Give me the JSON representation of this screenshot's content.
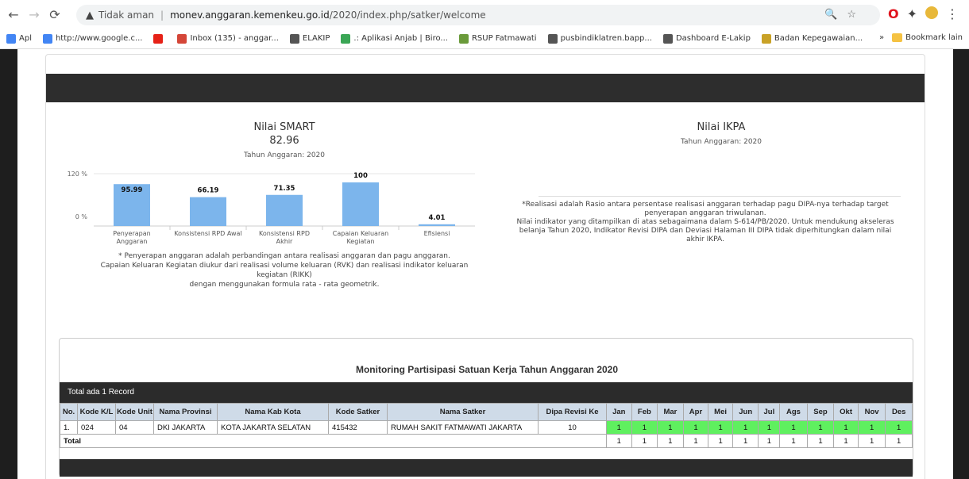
{
  "browser": {
    "security_label": "Tidak aman",
    "url_domain": "monev.anggaran.kemenkeu.go.id",
    "url_path": "/2020/index.php/satker/welcome"
  },
  "bookmarks": [
    {
      "label": "Apl",
      "icon": "apps-icon",
      "color": "#4285f4"
    },
    {
      "label": "http://www.google.c...",
      "icon": "google-icon",
      "color": "#4285f4"
    },
    {
      "label": "",
      "icon": "youtube-icon",
      "color": "#e62117"
    },
    {
      "label": "Inbox (135) - anggar...",
      "icon": "gmail-icon",
      "color": "#d44638"
    },
    {
      "label": "ELAKIP",
      "icon": "globe-icon",
      "color": "#555555"
    },
    {
      "label": ".: Aplikasi Anjab | Biro...",
      "icon": "star-icon",
      "color": "#3aa655"
    },
    {
      "label": "RSUP Fatmawati",
      "icon": "hospital-icon",
      "color": "#6a9a3a"
    },
    {
      "label": "pusbindiklatren.bapp...",
      "icon": "globe-icon",
      "color": "#555555"
    },
    {
      "label": "Dashboard E-Lakip",
      "icon": "globe-icon",
      "color": "#555555"
    },
    {
      "label": "Badan Kepegawaian...",
      "icon": "garuda-icon",
      "color": "#c9a227"
    }
  ],
  "bookmarks_more": "»",
  "bookmarks_other": "Bookmark lain",
  "smart": {
    "title": "Nilai SMART",
    "value": "82.96",
    "year": "Tahun Anggaran: 2020",
    "note_lines": [
      "* Penyerapan anggaran adalah perbandingan antara realisasi anggaran dan pagu anggaran.",
      "Capaian Keluaran Kegiatan diukur dari realisasi volume keluaran (RVK) dan realisasi indikator keluaran",
      "kegiatan (RIKK)",
      "dengan menggunakan formula rata - rata geometrik."
    ]
  },
  "ikpa": {
    "title": "Nilai IKPA",
    "year": "Tahun Anggaran: 2020",
    "note_lines": [
      "*Realisasi adalah Rasio antara persentase realisasi anggaran terhadap pagu DIPA-nya terhadap target",
      "penyerapan anggaran triwulanan.",
      "Nilai indikator yang ditampilkan di atas sebagaimana dalam S-614/PB/2020. Untuk mendukung akseleras",
      "belanja Tahun 2020, Indikator Revisi DIPA dan Deviasi Halaman III DIPA tidak diperhitungkan dalam nilai",
      "akhir IKPA."
    ]
  },
  "chart_data": {
    "type": "bar",
    "categories": [
      [
        "Penyerapan",
        "Anggaran"
      ],
      [
        "Konsistensi RPD Awal"
      ],
      [
        "Konsistensi RPD",
        "Akhir"
      ],
      [
        "Capaian Keluaran",
        "Kegiatan"
      ],
      [
        "Efisiensi"
      ]
    ],
    "values": [
      95.99,
      66.19,
      71.35,
      100,
      4.01
    ],
    "value_labels": [
      "95.99",
      "66.19",
      "71.35",
      "100",
      "4.01"
    ],
    "ylim": [
      0,
      120
    ],
    "y_ticks": [
      "120 %",
      "0 %"
    ],
    "bar_color": "#7cb5ec"
  },
  "monitoring": {
    "title": "Monitoring Partisipasi Satuan Kerja Tahun Anggaran 2020",
    "record_text": "Total ada 1 Record",
    "headers": [
      "No.",
      "Kode K/L",
      "Kode Unit",
      "Nama Provinsi",
      "Nama Kab Kota",
      "Kode Satker",
      "Nama Satker",
      "Dipa Revisi Ke",
      "Jan",
      "Feb",
      "Mar",
      "Apr",
      "Mei",
      "Jun",
      "Jul",
      "Ags",
      "Sep",
      "Okt",
      "Nov",
      "Des"
    ],
    "row": {
      "no": "1.",
      "kode_kl": "024",
      "kode_unit": "04",
      "provinsi": "DKI JAKARTA",
      "kab_kota": "KOTA JAKARTA SELATAN",
      "kode_satker": "415432",
      "nama_satker": "RUMAH SAKIT FATMAWATI JAKARTA",
      "dipa_revisi": "10",
      "months": [
        "1",
        "1",
        "1",
        "1",
        "1",
        "1",
        "1",
        "1",
        "1",
        "1",
        "1",
        "1"
      ]
    },
    "total_label": "Total",
    "total_months": [
      "1",
      "1",
      "1",
      "1",
      "1",
      "1",
      "1",
      "1",
      "1",
      "1",
      "1",
      "1"
    ]
  }
}
